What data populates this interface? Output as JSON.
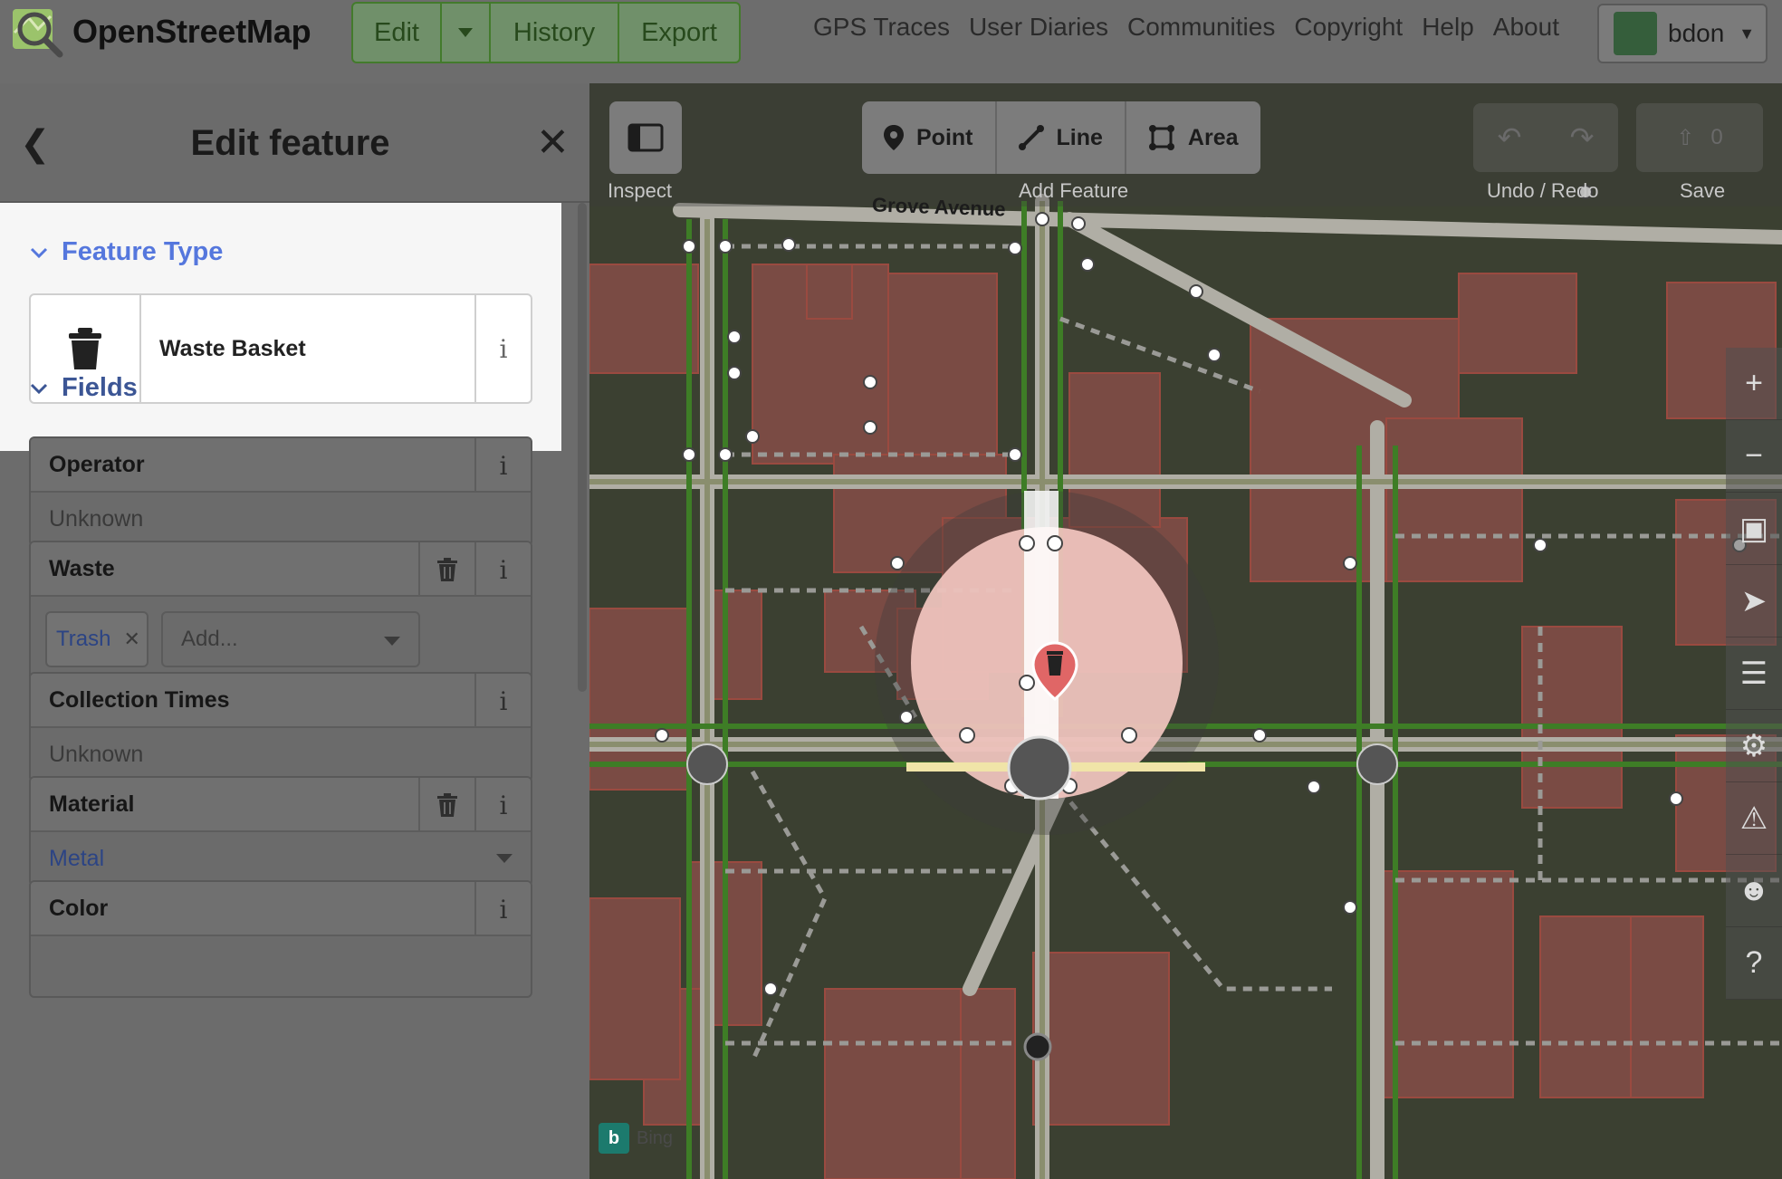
{
  "app": {
    "name": "OpenStreetMap"
  },
  "nav": {
    "edit": "Edit",
    "history": "History",
    "export": "Export",
    "links": [
      "GPS Traces",
      "User Diaries",
      "Communities",
      "Copyright",
      "Help",
      "About"
    ],
    "user": "bdon"
  },
  "sidebar": {
    "title": "Edit feature",
    "feature_type_heading": "Feature Type",
    "feature_type": "Waste Basket",
    "fields_heading": "Fields",
    "fields": {
      "operator": {
        "label": "Operator",
        "placeholder": "Unknown"
      },
      "waste": {
        "label": "Waste",
        "chip": "Trash",
        "add_placeholder": "Add..."
      },
      "collection_times": {
        "label": "Collection Times",
        "placeholder": "Unknown"
      },
      "material": {
        "label": "Material",
        "value": "Metal"
      },
      "color": {
        "label": "Color"
      }
    }
  },
  "map": {
    "inspect_label": "Inspect",
    "modes": {
      "point": "Point",
      "line": "Line",
      "area": "Area"
    },
    "add_feature_label": "Add Feature",
    "undo_redo_label": "Undo / Redo",
    "save_label": "Save",
    "save_count": "0",
    "street": "Grove Avenue",
    "imagery": "Bing"
  },
  "colors": {
    "accent": "#5577dd",
    "edit_green": "#437b2c",
    "selection": "#f3c7c0"
  }
}
